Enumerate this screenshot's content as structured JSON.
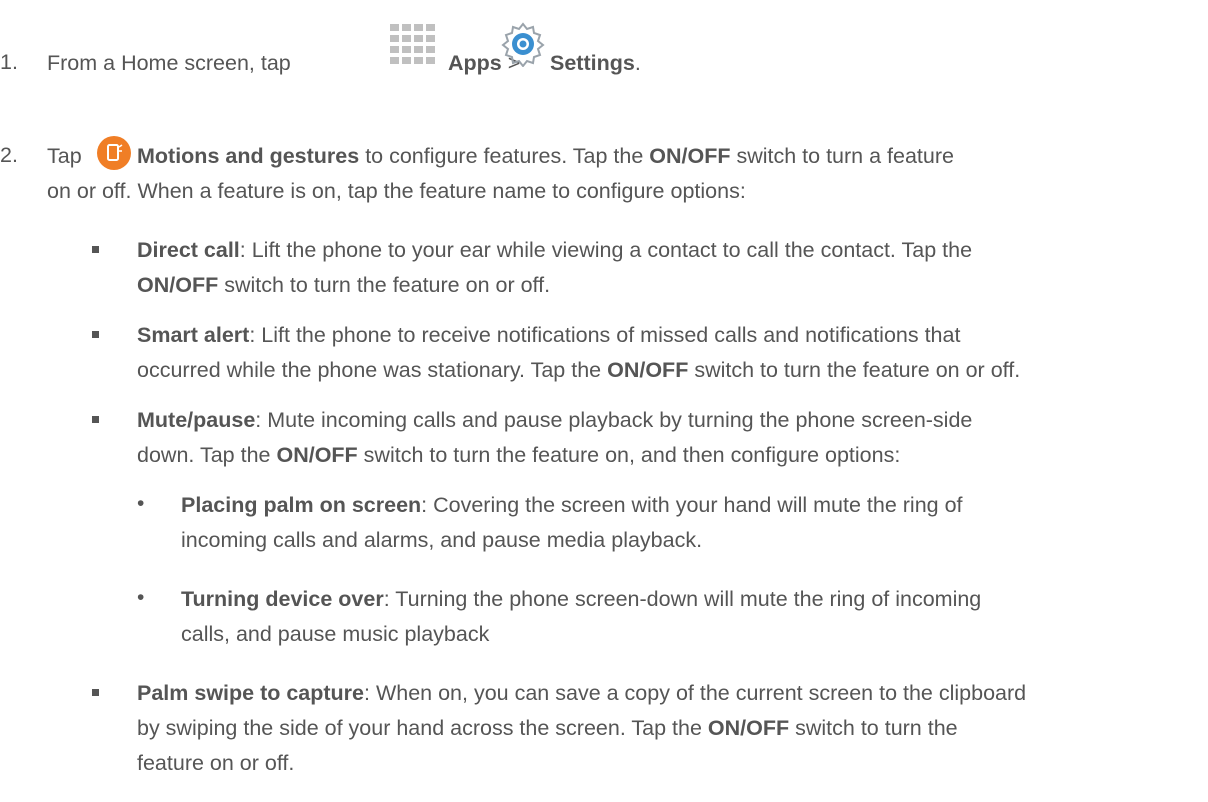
{
  "step1": {
    "number": "1.",
    "text_before": "From a Home screen, tap",
    "apps_label": "Apps",
    "separator": ">",
    "settings_label": "Settings",
    "period": "."
  },
  "step2": {
    "number": "2.",
    "tap": "Tap",
    "motions_label": "Motions and gestures",
    "after_motions": "to configure features. Tap the",
    "onoff": "ON/OFF",
    "after_onoff": "switch to turn a feature",
    "line2": "on or off. When a feature is on, tap the feature name to configure options:"
  },
  "direct_call": {
    "title": "Direct call",
    "line1_rest": ": Lift the phone to your ear while viewing a contact to call the contact. Tap the",
    "onoff": "ON/OFF",
    "line2_rest": "switch to turn the feature on or off."
  },
  "smart_alert": {
    "title": "Smart alert",
    "line1_rest": ": Lift the phone to receive notifications of missed calls and notifications that",
    "line2_before": "occurred while the phone was stationary. Tap the",
    "onoff": "ON/OFF",
    "line2_after": "switch to turn the feature on or off."
  },
  "mute_pause": {
    "title": "Mute/pause",
    "line1_rest": ": Mute incoming calls and pause playback by turning the phone screen-side",
    "line2_before": "down. Tap the",
    "onoff": "ON/OFF",
    "line2_after": "switch to turn the feature on, and then configure options:"
  },
  "palm_on_screen": {
    "bullet": "•",
    "title": "Placing palm on screen",
    "line1_rest": ": Covering the screen with your hand will mute the ring of",
    "line2": "incoming calls and alarms, and pause media playback."
  },
  "turning_over": {
    "bullet": "•",
    "title": "Turning device over",
    "line1_rest": ": Turning the phone screen-down will mute the ring of incoming",
    "line2": "calls, and pause music playback"
  },
  "palm_swipe": {
    "title": "Palm swipe to capture",
    "line1_rest": ": When on, you can save a copy of the current screen to the clipboard",
    "line2_before": "by swiping the side of your hand across the screen. Tap the",
    "onoff": "ON/OFF",
    "line2_after": "switch to turn the",
    "line3": "feature on or off."
  },
  "icons": {
    "apps": "apps-grid-icon",
    "settings": "settings-gear-icon",
    "motions": "motions-gestures-icon",
    "accent": "#f07e26",
    "gear_blue": "#3a8fd0"
  }
}
